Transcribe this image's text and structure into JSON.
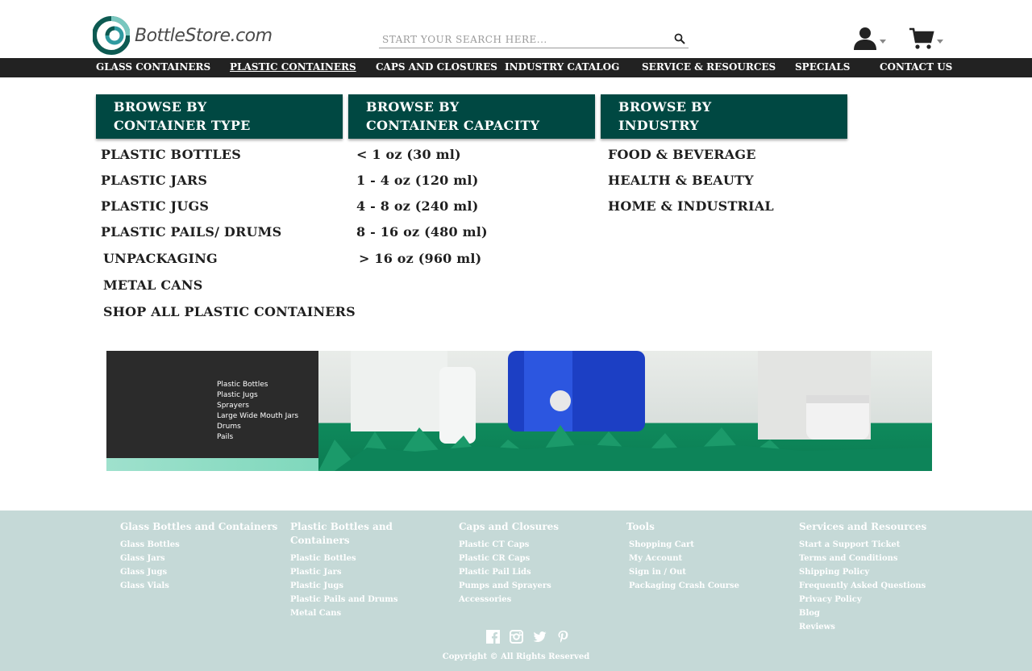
{
  "header": {
    "logo_text": "BottleStore.com",
    "search_placeholder": "START YOUR SEARCH HERE..."
  },
  "nav": {
    "items": [
      "GLASS CONTAINERS",
      "PLASTIC CONTAINERS",
      "CAPS AND CLOSURES",
      "INDUSTRY CATALOG",
      "SERVICE & RESOURCES",
      "SPECIALS",
      "CONTACT US"
    ],
    "active": "PLASTIC CONTAINERS"
  },
  "mega_menu": {
    "columns": [
      {
        "heading_line1": "BROWSE BY",
        "heading_line2": "CONTAINER TYPE",
        "items": [
          "PLASTIC BOTTLES",
          "PLASTIC JARS",
          "PLASTIC JUGS",
          "PLASTIC PAILS/ DRUMS",
          "UNPACKAGING",
          "METAL CANS",
          "SHOP ALL PLASTIC CONTAINERS"
        ]
      },
      {
        "heading_line1": "BROWSE BY",
        "heading_line2": "CONTAINER CAPACITY",
        "items": [
          "< 1 oz (30 ml)",
          "1 - 4 oz (120 ml)",
          "4 - 8 oz (240 ml)",
          "8 - 16 oz (480 ml)",
          "> 16 oz (960 ml)"
        ]
      },
      {
        "heading_line1": "BROWSE BY",
        "heading_line2": "INDUSTRY",
        "items": [
          "FOOD & BEVERAGE",
          "HEALTH & BEAUTY",
          "HOME & INDUSTRIAL"
        ]
      }
    ]
  },
  "banner": {
    "list": [
      "Plastic Bottles",
      "Plastic Jugs",
      "Sprayers",
      "Large Wide Mouth Jars",
      "Drums",
      "Pails"
    ]
  },
  "footer": {
    "columns": [
      {
        "heading": "Glass Bottles and Containers",
        "links": [
          "Glass Bottles",
          "Glass Jars",
          "Glass Jugs",
          "Glass Vials"
        ]
      },
      {
        "heading_line1": "Plastic Bottles and",
        "heading_line2": "Containers",
        "links": [
          "Plastic Bottles",
          "Plastic Jars",
          "Plastic Jugs",
          "Plastic Pails and Drums",
          "Metal Cans"
        ]
      },
      {
        "heading": "Caps and Closures",
        "links": [
          "Plastic CT Caps",
          "Plastic CR Caps",
          "Plastic Pail Lids",
          "Pumps and Sprayers",
          "Accessories"
        ]
      },
      {
        "heading": "Tools",
        "links": [
          "Shopping Cart",
          "My Account",
          "Sign in / Out",
          "Packaging Crash Course"
        ]
      },
      {
        "heading": "Services and Resources",
        "links": [
          "Start a Support Ticket",
          "Terms and Conditions",
          "Shipping Policy",
          "Frequently Asked Questions",
          "Privacy Policy",
          "Blog",
          "Reviews"
        ]
      }
    ],
    "social_icons": [
      "facebook-icon",
      "instagram-icon",
      "twitter-icon",
      "pinterest-icon"
    ],
    "copyright": "Copyright © All Rights Reserved"
  },
  "colors": {
    "menu_heading_bg": "#004842",
    "nav_bg": "#222222",
    "footer_bg": "#c5d9d7"
  }
}
